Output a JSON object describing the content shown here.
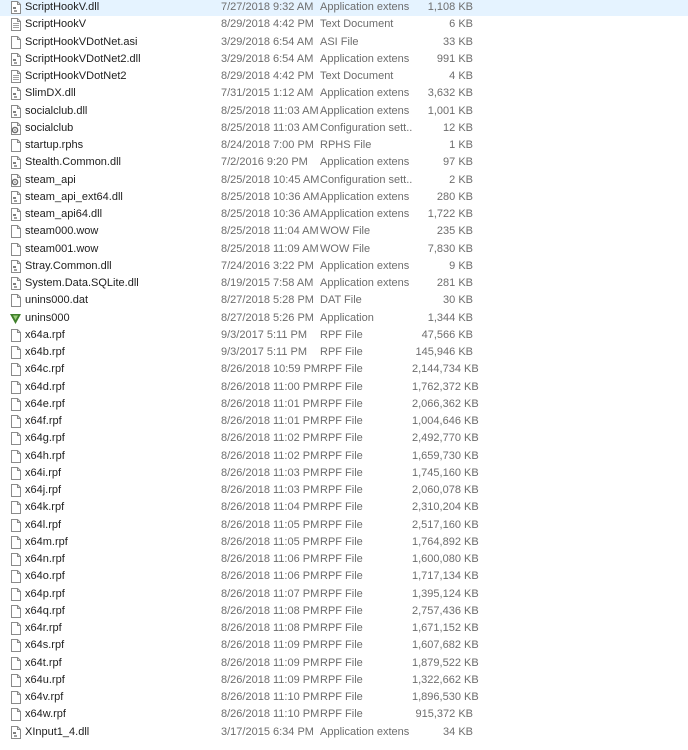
{
  "files": [
    {
      "name": "ScriptHookV.dll",
      "date": "7/27/2018 9:32 AM",
      "type": "Application extens",
      "size": "1,108 KB",
      "icon": "dll-file-icon"
    },
    {
      "name": "ScriptHookV",
      "date": "8/29/2018 4:42 PM",
      "type": "Text Document",
      "size": "6 KB",
      "icon": "text-file-icon"
    },
    {
      "name": "ScriptHookVDotNet.asi",
      "date": "3/29/2018 6:54 AM",
      "type": "ASI File",
      "size": "33 KB",
      "icon": "generic-file-icon"
    },
    {
      "name": "ScriptHookVDotNet2.dll",
      "date": "3/29/2018 6:54 AM",
      "type": "Application extens",
      "size": "991 KB",
      "icon": "dll-file-icon"
    },
    {
      "name": "ScriptHookVDotNet2",
      "date": "8/29/2018 4:42 PM",
      "type": "Text Document",
      "size": "4 KB",
      "icon": "text-file-icon"
    },
    {
      "name": "SlimDX.dll",
      "date": "7/31/2015 1:12 AM",
      "type": "Application extens",
      "size": "3,632 KB",
      "icon": "dll-file-icon"
    },
    {
      "name": "socialclub.dll",
      "date": "8/25/2018 11:03 AM",
      "type": "Application extens",
      "size": "1,001 KB",
      "icon": "dll-file-icon"
    },
    {
      "name": "socialclub",
      "date": "8/25/2018 11:03 AM",
      "type": "Configuration sett...",
      "size": "12 KB",
      "icon": "config-file-icon"
    },
    {
      "name": "startup.rphs",
      "date": "8/24/2018 7:00 PM",
      "type": "RPHS File",
      "size": "1 KB",
      "icon": "generic-file-icon"
    },
    {
      "name": "Stealth.Common.dll",
      "date": "7/2/2016 9:20 PM",
      "type": "Application extens",
      "size": "97 KB",
      "icon": "dll-file-icon"
    },
    {
      "name": "steam_api",
      "date": "8/25/2018 10:45 AM",
      "type": "Configuration sett...",
      "size": "2 KB",
      "icon": "config-file-icon"
    },
    {
      "name": "steam_api_ext64.dll",
      "date": "8/25/2018 10:36 AM",
      "type": "Application extens",
      "size": "280 KB",
      "icon": "dll-file-icon"
    },
    {
      "name": "steam_api64.dll",
      "date": "8/25/2018 10:36 AM",
      "type": "Application extens",
      "size": "1,722 KB",
      "icon": "dll-file-icon"
    },
    {
      "name": "steam000.wow",
      "date": "8/25/2018 11:04 AM",
      "type": "WOW File",
      "size": "235 KB",
      "icon": "generic-file-icon"
    },
    {
      "name": "steam001.wow",
      "date": "8/25/2018 11:09 AM",
      "type": "WOW File",
      "size": "7,830 KB",
      "icon": "generic-file-icon"
    },
    {
      "name": "Stray.Common.dll",
      "date": "7/24/2016 3:22 PM",
      "type": "Application extens",
      "size": "9 KB",
      "icon": "dll-file-icon"
    },
    {
      "name": "System.Data.SQLite.dll",
      "date": "8/19/2015 7:58 AM",
      "type": "Application extens",
      "size": "281 KB",
      "icon": "dll-file-icon"
    },
    {
      "name": "unins000.dat",
      "date": "8/27/2018 5:28 PM",
      "type": "DAT File",
      "size": "30 KB",
      "icon": "generic-file-icon"
    },
    {
      "name": "unins000",
      "date": "8/27/2018 5:26 PM",
      "type": "Application",
      "size": "1,344 KB",
      "icon": "uninstaller-icon"
    },
    {
      "name": "x64a.rpf",
      "date": "9/3/2017 5:11 PM",
      "type": "RPF File",
      "size": "47,566 KB",
      "icon": "generic-file-icon"
    },
    {
      "name": "x64b.rpf",
      "date": "9/3/2017 5:11 PM",
      "type": "RPF File",
      "size": "145,946 KB",
      "icon": "generic-file-icon"
    },
    {
      "name": "x64c.rpf",
      "date": "8/26/2018 10:59 PM",
      "type": "RPF File",
      "size": "2,144,734 KB",
      "icon": "generic-file-icon"
    },
    {
      "name": "x64d.rpf",
      "date": "8/26/2018 11:00 PM",
      "type": "RPF File",
      "size": "1,762,372 KB",
      "icon": "generic-file-icon"
    },
    {
      "name": "x64e.rpf",
      "date": "8/26/2018 11:01 PM",
      "type": "RPF File",
      "size": "2,066,362 KB",
      "icon": "generic-file-icon"
    },
    {
      "name": "x64f.rpf",
      "date": "8/26/2018 11:01 PM",
      "type": "RPF File",
      "size": "1,004,646 KB",
      "icon": "generic-file-icon"
    },
    {
      "name": "x64g.rpf",
      "date": "8/26/2018 11:02 PM",
      "type": "RPF File",
      "size": "2,492,770 KB",
      "icon": "generic-file-icon"
    },
    {
      "name": "x64h.rpf",
      "date": "8/26/2018 11:02 PM",
      "type": "RPF File",
      "size": "1,659,730 KB",
      "icon": "generic-file-icon"
    },
    {
      "name": "x64i.rpf",
      "date": "8/26/2018 11:03 PM",
      "type": "RPF File",
      "size": "1,745,160 KB",
      "icon": "generic-file-icon"
    },
    {
      "name": "x64j.rpf",
      "date": "8/26/2018 11:03 PM",
      "type": "RPF File",
      "size": "2,060,078 KB",
      "icon": "generic-file-icon"
    },
    {
      "name": "x64k.rpf",
      "date": "8/26/2018 11:04 PM",
      "type": "RPF File",
      "size": "2,310,204 KB",
      "icon": "generic-file-icon"
    },
    {
      "name": "x64l.rpf",
      "date": "8/26/2018 11:05 PM",
      "type": "RPF File",
      "size": "2,517,160 KB",
      "icon": "generic-file-icon"
    },
    {
      "name": "x64m.rpf",
      "date": "8/26/2018 11:05 PM",
      "type": "RPF File",
      "size": "1,764,892 KB",
      "icon": "generic-file-icon"
    },
    {
      "name": "x64n.rpf",
      "date": "8/26/2018 11:06 PM",
      "type": "RPF File",
      "size": "1,600,080 KB",
      "icon": "generic-file-icon"
    },
    {
      "name": "x64o.rpf",
      "date": "8/26/2018 11:06 PM",
      "type": "RPF File",
      "size": "1,717,134 KB",
      "icon": "generic-file-icon"
    },
    {
      "name": "x64p.rpf",
      "date": "8/26/2018 11:07 PM",
      "type": "RPF File",
      "size": "1,395,124 KB",
      "icon": "generic-file-icon"
    },
    {
      "name": "x64q.rpf",
      "date": "8/26/2018 11:08 PM",
      "type": "RPF File",
      "size": "2,757,436 KB",
      "icon": "generic-file-icon"
    },
    {
      "name": "x64r.rpf",
      "date": "8/26/2018 11:08 PM",
      "type": "RPF File",
      "size": "1,671,152 KB",
      "icon": "generic-file-icon"
    },
    {
      "name": "x64s.rpf",
      "date": "8/26/2018 11:09 PM",
      "type": "RPF File",
      "size": "1,607,682 KB",
      "icon": "generic-file-icon"
    },
    {
      "name": "x64t.rpf",
      "date": "8/26/2018 11:09 PM",
      "type": "RPF File",
      "size": "1,879,522 KB",
      "icon": "generic-file-icon"
    },
    {
      "name": "x64u.rpf",
      "date": "8/26/2018 11:09 PM",
      "type": "RPF File",
      "size": "1,322,662 KB",
      "icon": "generic-file-icon"
    },
    {
      "name": "x64v.rpf",
      "date": "8/26/2018 11:10 PM",
      "type": "RPF File",
      "size": "1,896,530 KB",
      "icon": "generic-file-icon"
    },
    {
      "name": "x64w.rpf",
      "date": "8/26/2018 11:10 PM",
      "type": "RPF File",
      "size": "915,372 KB",
      "icon": "generic-file-icon"
    },
    {
      "name": "XInput1_4.dll",
      "date": "3/17/2015 6:34 PM",
      "type": "Application extens",
      "size": "34 KB",
      "icon": "dll-file-icon"
    }
  ],
  "colors": {
    "uninstaller_green": "#3f7f2a",
    "icon_border": "#8a8a8a",
    "config_gear": "#6b6b6b"
  }
}
